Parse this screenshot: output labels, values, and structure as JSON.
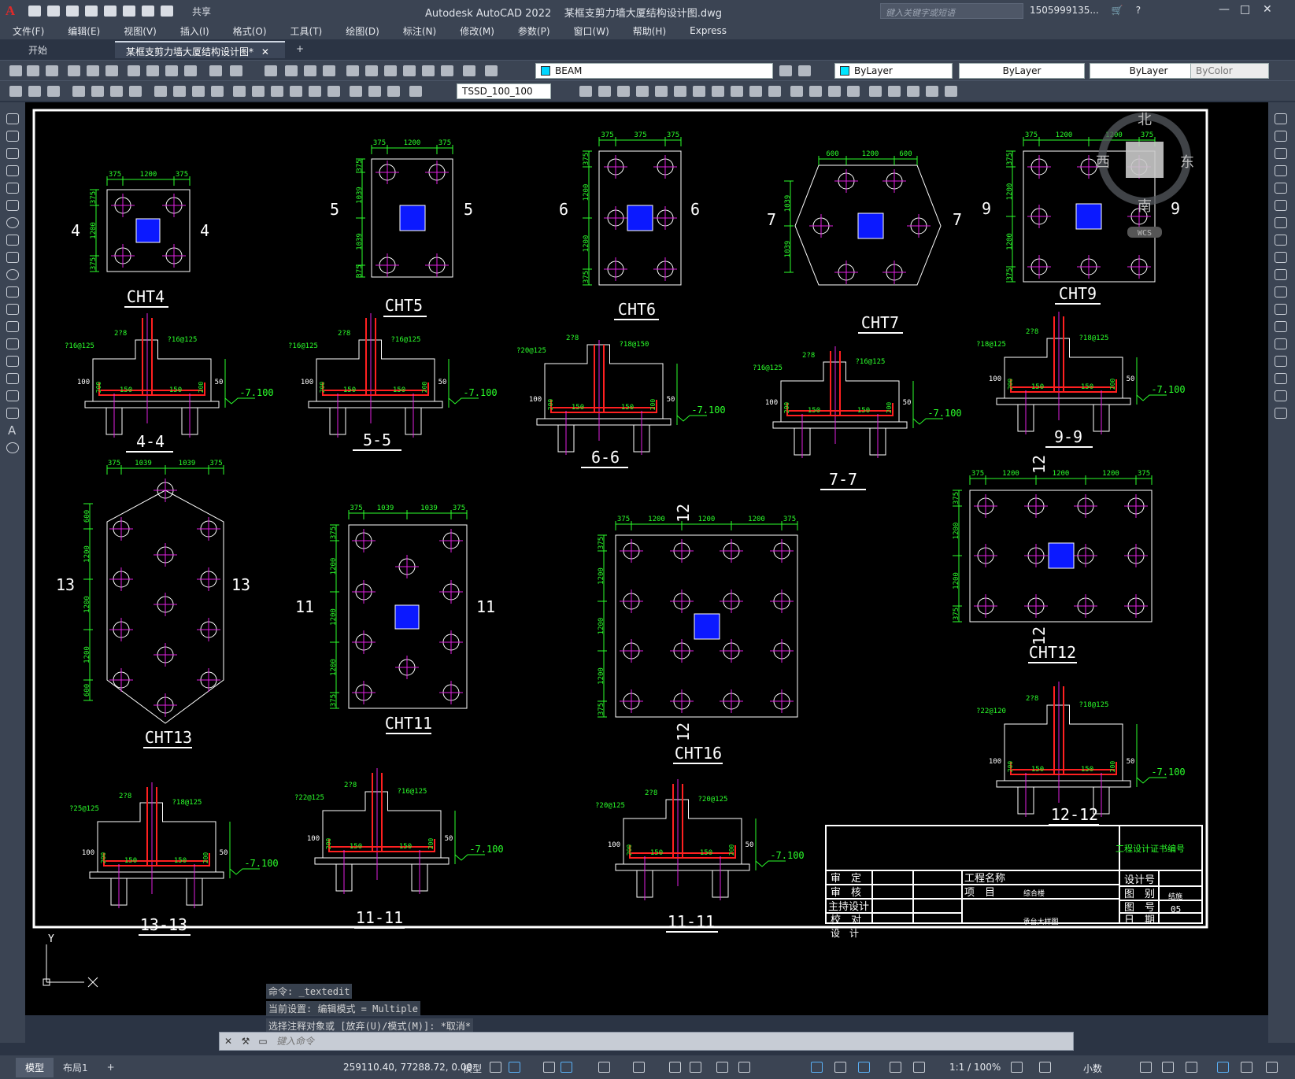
{
  "app": {
    "logo": "A",
    "title": "Autodesk AutoCAD 2022",
    "filename": "某框支剪力墙大厦结构设计图.dwg"
  },
  "quick_access": {
    "share_label": "共享"
  },
  "search": {
    "placeholder": "键入关键字或短语"
  },
  "user": {
    "name": "1505999135...",
    "cart_icon": "cart-icon",
    "help_icon": "help-icon"
  },
  "menu": [
    "文件(F)",
    "编辑(E)",
    "视图(V)",
    "插入(I)",
    "格式(O)",
    "工具(T)",
    "绘图(D)",
    "标注(N)",
    "修改(M)",
    "参数(P)",
    "窗口(W)",
    "帮助(H)",
    "Express"
  ],
  "doc_tabs": {
    "start": "开始",
    "active": "某框支剪力墙大厦结构设计图*",
    "add": "+"
  },
  "toolbar": {
    "layer": "BEAM",
    "color": "ByLayer",
    "linetype": "ByLayer",
    "lineweight": "ByLayer",
    "plotstyle": "ByColor",
    "dimstyle": "TSSD_100_100"
  },
  "viewcube": {
    "north": "北",
    "south": "南",
    "east": "东",
    "west": "西",
    "wcs": "WCS"
  },
  "ucs": {
    "y": "Y"
  },
  "drawing": {
    "plans": [
      {
        "label": "CHT4",
        "cut": "4"
      },
      {
        "label": "CHT5",
        "cut": "5"
      },
      {
        "label": "CHT6",
        "cut": "6"
      },
      {
        "label": "CHT7",
        "cut": "7"
      },
      {
        "label": "CHT9",
        "cut": "9"
      },
      {
        "label": "CHT13",
        "cut": "13"
      },
      {
        "label": "CHT11",
        "cut": "11"
      },
      {
        "label": "CHT16",
        "cut": "12"
      },
      {
        "label": "CHT12",
        "cut": "12"
      }
    ],
    "sections": [
      "4-4",
      "5-5",
      "6-6",
      "7-7",
      "9-9",
      "13-13",
      "11-11",
      "11-11",
      "12-12"
    ],
    "dims": {
      "d375": "375",
      "d1200": "1200",
      "d1039": "1039",
      "d600": "600"
    },
    "elev": "-7.100",
    "rebar": {
      "a": "?16@125",
      "b": "?18@125",
      "c": "?20@125",
      "d": "?22@120",
      "e": "?25@125",
      "f": "?18@150",
      "g": "2?8",
      "h": "?22@125"
    },
    "sec_dims": {
      "s100": "100",
      "s150": "150",
      "s200": "200",
      "s50": "50"
    }
  },
  "title_block": {
    "cert": "工程设计证书编号",
    "project_name_label": "工程名称",
    "item_label": "项　目",
    "item_value": "综合楼",
    "drawing_title": "承台大样图",
    "rows": [
      "审　定",
      "审　核",
      "主持设计",
      "校　对",
      "设　计"
    ],
    "right_labels": [
      "设计号",
      "图　别",
      "图　号",
      "日　期"
    ],
    "right_values": [
      "",
      "结施",
      "05",
      ""
    ]
  },
  "command": {
    "history": [
      "命令: _textedit",
      "当前设置: 编辑模式 = Multiple",
      "选择注释对象或 [放弃(U)/模式(M)]: *取消*"
    ],
    "placeholder": "键入命令"
  },
  "status": {
    "model_tab": "模型",
    "layout_tab": "布局1",
    "add": "+",
    "coords": "259110.40, 77288.72, 0.00",
    "space": "模型",
    "scale": "1:1 / 100%",
    "units": "小数"
  }
}
